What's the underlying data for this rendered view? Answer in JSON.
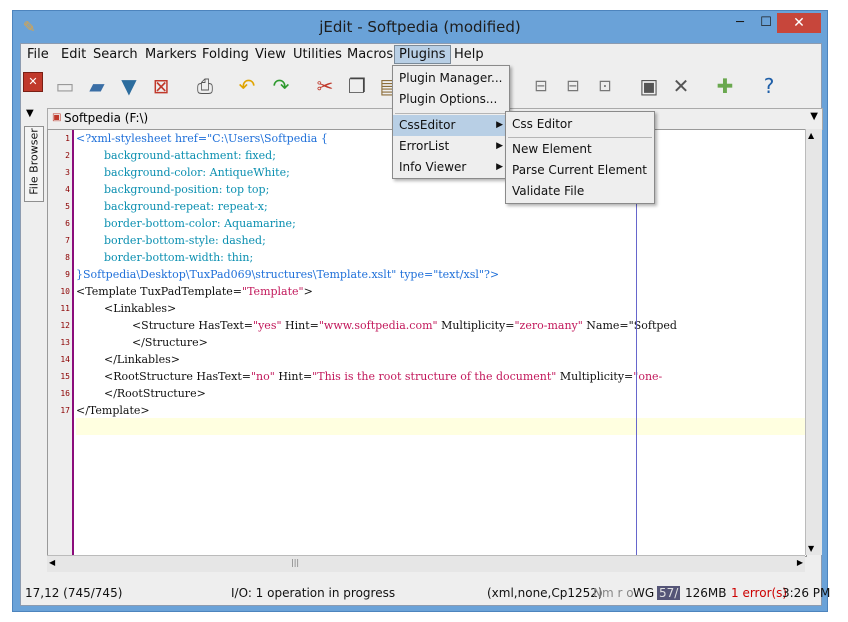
{
  "window": {
    "title": "jEdit - Softpedia (modified)"
  },
  "menubar": [
    "File",
    "Edit",
    "Search",
    "Markers",
    "Folding",
    "View",
    "Utilities",
    "Macros",
    "Plugins",
    "Help"
  ],
  "buffer": {
    "name": "Softpedia (F:\\)"
  },
  "side_tab": "File Browser",
  "gutter": [
    "1",
    "2",
    "3",
    "4",
    "5",
    "6",
    "7",
    "8",
    "9",
    "10",
    "11",
    "12",
    "13",
    "14",
    "15",
    "16",
    "17"
  ],
  "code_lines": [
    [
      {
        "t": "<?xml-stylesheet href=\"C:\\Users\\Softpedia {",
        "c": "#1e6fd9"
      }
    ],
    [
      {
        "t": "        background-attachment: fixed;",
        "c": "#0a8fb0"
      }
    ],
    [
      {
        "t": "        background-color: AntiqueWhite;",
        "c": "#0a8fb0"
      }
    ],
    [
      {
        "t": "        background-position: top top;",
        "c": "#0a8fb0"
      }
    ],
    [
      {
        "t": "        background-repeat: repeat-x;",
        "c": "#0a8fb0"
      }
    ],
    [
      {
        "t": "        border-bottom-color: Aquamarine;",
        "c": "#0a8fb0"
      }
    ],
    [
      {
        "t": "        border-bottom-style: dashed;",
        "c": "#0a8fb0"
      }
    ],
    [
      {
        "t": "        border-bottom-width: thin;",
        "c": "#0a8fb0"
      }
    ],
    [
      {
        "t": "}Softpedia\\Desktop\\TuxPad069\\structures\\Template.xslt\" type=\"text/xsl\"?>",
        "c": "#1e6fd9"
      }
    ],
    [
      {
        "t": "<Template TuxPadTemplate=",
        "c": "#111111"
      },
      {
        "t": "\"Template\"",
        "c": "#c2185b"
      },
      {
        "t": ">",
        "c": "#111111"
      }
    ],
    [
      {
        "t": "        <Linkables>",
        "c": "#111111"
      }
    ],
    [
      {
        "t": "                <Structure HasText=",
        "c": "#111111"
      },
      {
        "t": "\"yes\"",
        "c": "#c2185b"
      },
      {
        "t": " Hint=",
        "c": "#111111"
      },
      {
        "t": "\"www.softpedia.com\"",
        "c": "#c2185b"
      },
      {
        "t": " Multiplicity=",
        "c": "#111111"
      },
      {
        "t": "\"zero-many\"",
        "c": "#c2185b"
      },
      {
        "t": " Name=\"Softped",
        "c": "#111111"
      }
    ],
    [
      {
        "t": "                </Structure>",
        "c": "#111111"
      }
    ],
    [
      {
        "t": "        </Linkables>",
        "c": "#111111"
      }
    ],
    [
      {
        "t": "        <RootStructure HasText=",
        "c": "#111111"
      },
      {
        "t": "\"no\"",
        "c": "#c2185b"
      },
      {
        "t": " Hint=",
        "c": "#111111"
      },
      {
        "t": "\"This is the root structure of the document\"",
        "c": "#c2185b"
      },
      {
        "t": " Multiplicity=",
        "c": "#111111"
      },
      {
        "t": "\"one-",
        "c": "#c2185b"
      }
    ],
    [
      {
        "t": "        </RootStructure>",
        "c": "#111111"
      }
    ],
    [
      {
        "t": "</Template>",
        "c": "#111111"
      }
    ]
  ],
  "plugins_menu": {
    "items": [
      "Plugin Manager...",
      "Plugin Options...",
      "CssEditor",
      "ErrorList",
      "Info Viewer"
    ]
  },
  "csseditor_menu": {
    "items": [
      "Css Editor",
      "New Element",
      "Parse Current Element",
      "Validate File"
    ]
  },
  "statusbar": {
    "caret": "17,12 (745/745)",
    "io": "I/O: 1 operation in progress",
    "mode": "(xml,none,Cp1252)",
    "flags": "Nm r o",
    "wg": "WG",
    "memory_used": "57/",
    "memory_total": "126MB",
    "errors": "1 error(s)",
    "time": "3:26 PM"
  },
  "colors": {
    "title_bar": "#6aa2d8",
    "close": "#c7463b",
    "gutter_border": "#8b0c7b",
    "menu_highlight": "#b8cfe5"
  }
}
